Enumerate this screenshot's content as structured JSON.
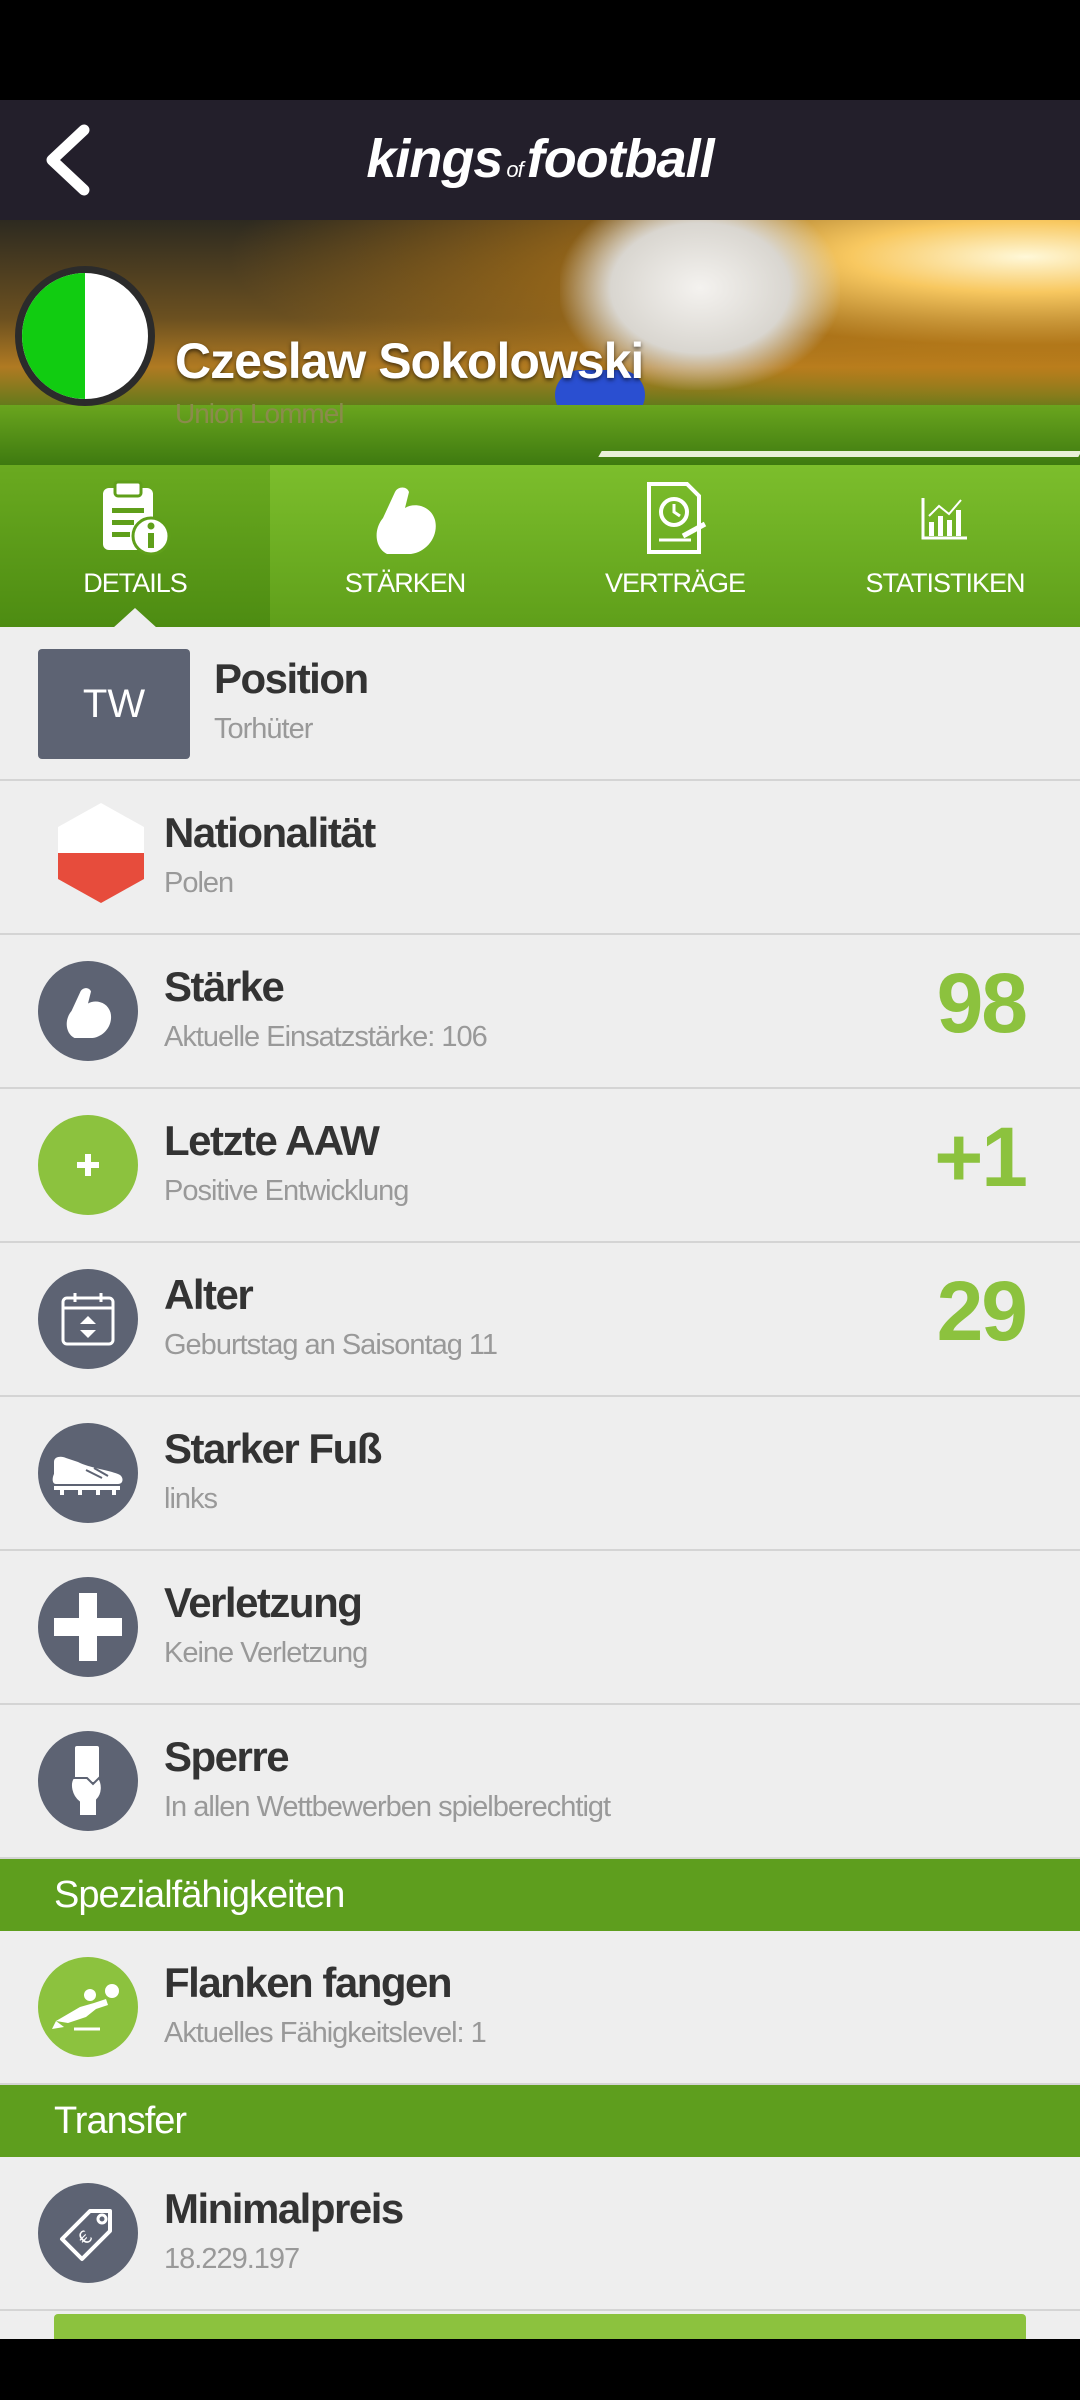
{
  "header": {
    "logo_main": "kings",
    "logo_of": "of",
    "logo_end": "football"
  },
  "player": {
    "name": "Czeslaw Sokolowski",
    "club": "Union Lommel"
  },
  "tabs": [
    {
      "label": "DETAILS",
      "icon": "clipboard-info-icon"
    },
    {
      "label": "STÄRKEN",
      "icon": "flexed-arm-icon"
    },
    {
      "label": "VERTRÄGE",
      "icon": "contract-clock-icon"
    },
    {
      "label": "STATISTIKEN",
      "icon": "bar-chart-icon"
    }
  ],
  "details": {
    "position": {
      "badge": "TW",
      "title": "Position",
      "sub": "Torhüter"
    },
    "nationality": {
      "title": "Nationalität",
      "sub": "Polen"
    },
    "strength": {
      "title": "Stärke",
      "sub": "Aktuelle Einsatzstärke: 106",
      "value": "98"
    },
    "last_aaw": {
      "title": "Letzte AAW",
      "sub": "Positive Entwicklung",
      "value": "+1"
    },
    "age": {
      "title": "Alter",
      "sub": "Geburtstag an Saisontag 11",
      "value": "29"
    },
    "foot": {
      "title": "Starker Fuß",
      "sub": "links"
    },
    "injury": {
      "title": "Verletzung",
      "sub": "Keine Verletzung"
    },
    "suspension": {
      "title": "Sperre",
      "sub": "In allen Wettbewerben spielberechtigt"
    }
  },
  "special": {
    "header": "Spezialfähigkeiten",
    "ability": {
      "title": "Flanken fangen",
      "sub": "Aktuelles Fähigkeitslevel: 1"
    }
  },
  "transfer": {
    "header": "Transfer",
    "min_price": {
      "title": "Minimalpreis",
      "sub": "18.229.197"
    }
  },
  "colors": {
    "accent_green": "#8cc23e",
    "tab_green": "#6aaa20",
    "header_dark": "#231f2b",
    "icon_slate": "#5d6373",
    "club_color": "#11cc11"
  }
}
